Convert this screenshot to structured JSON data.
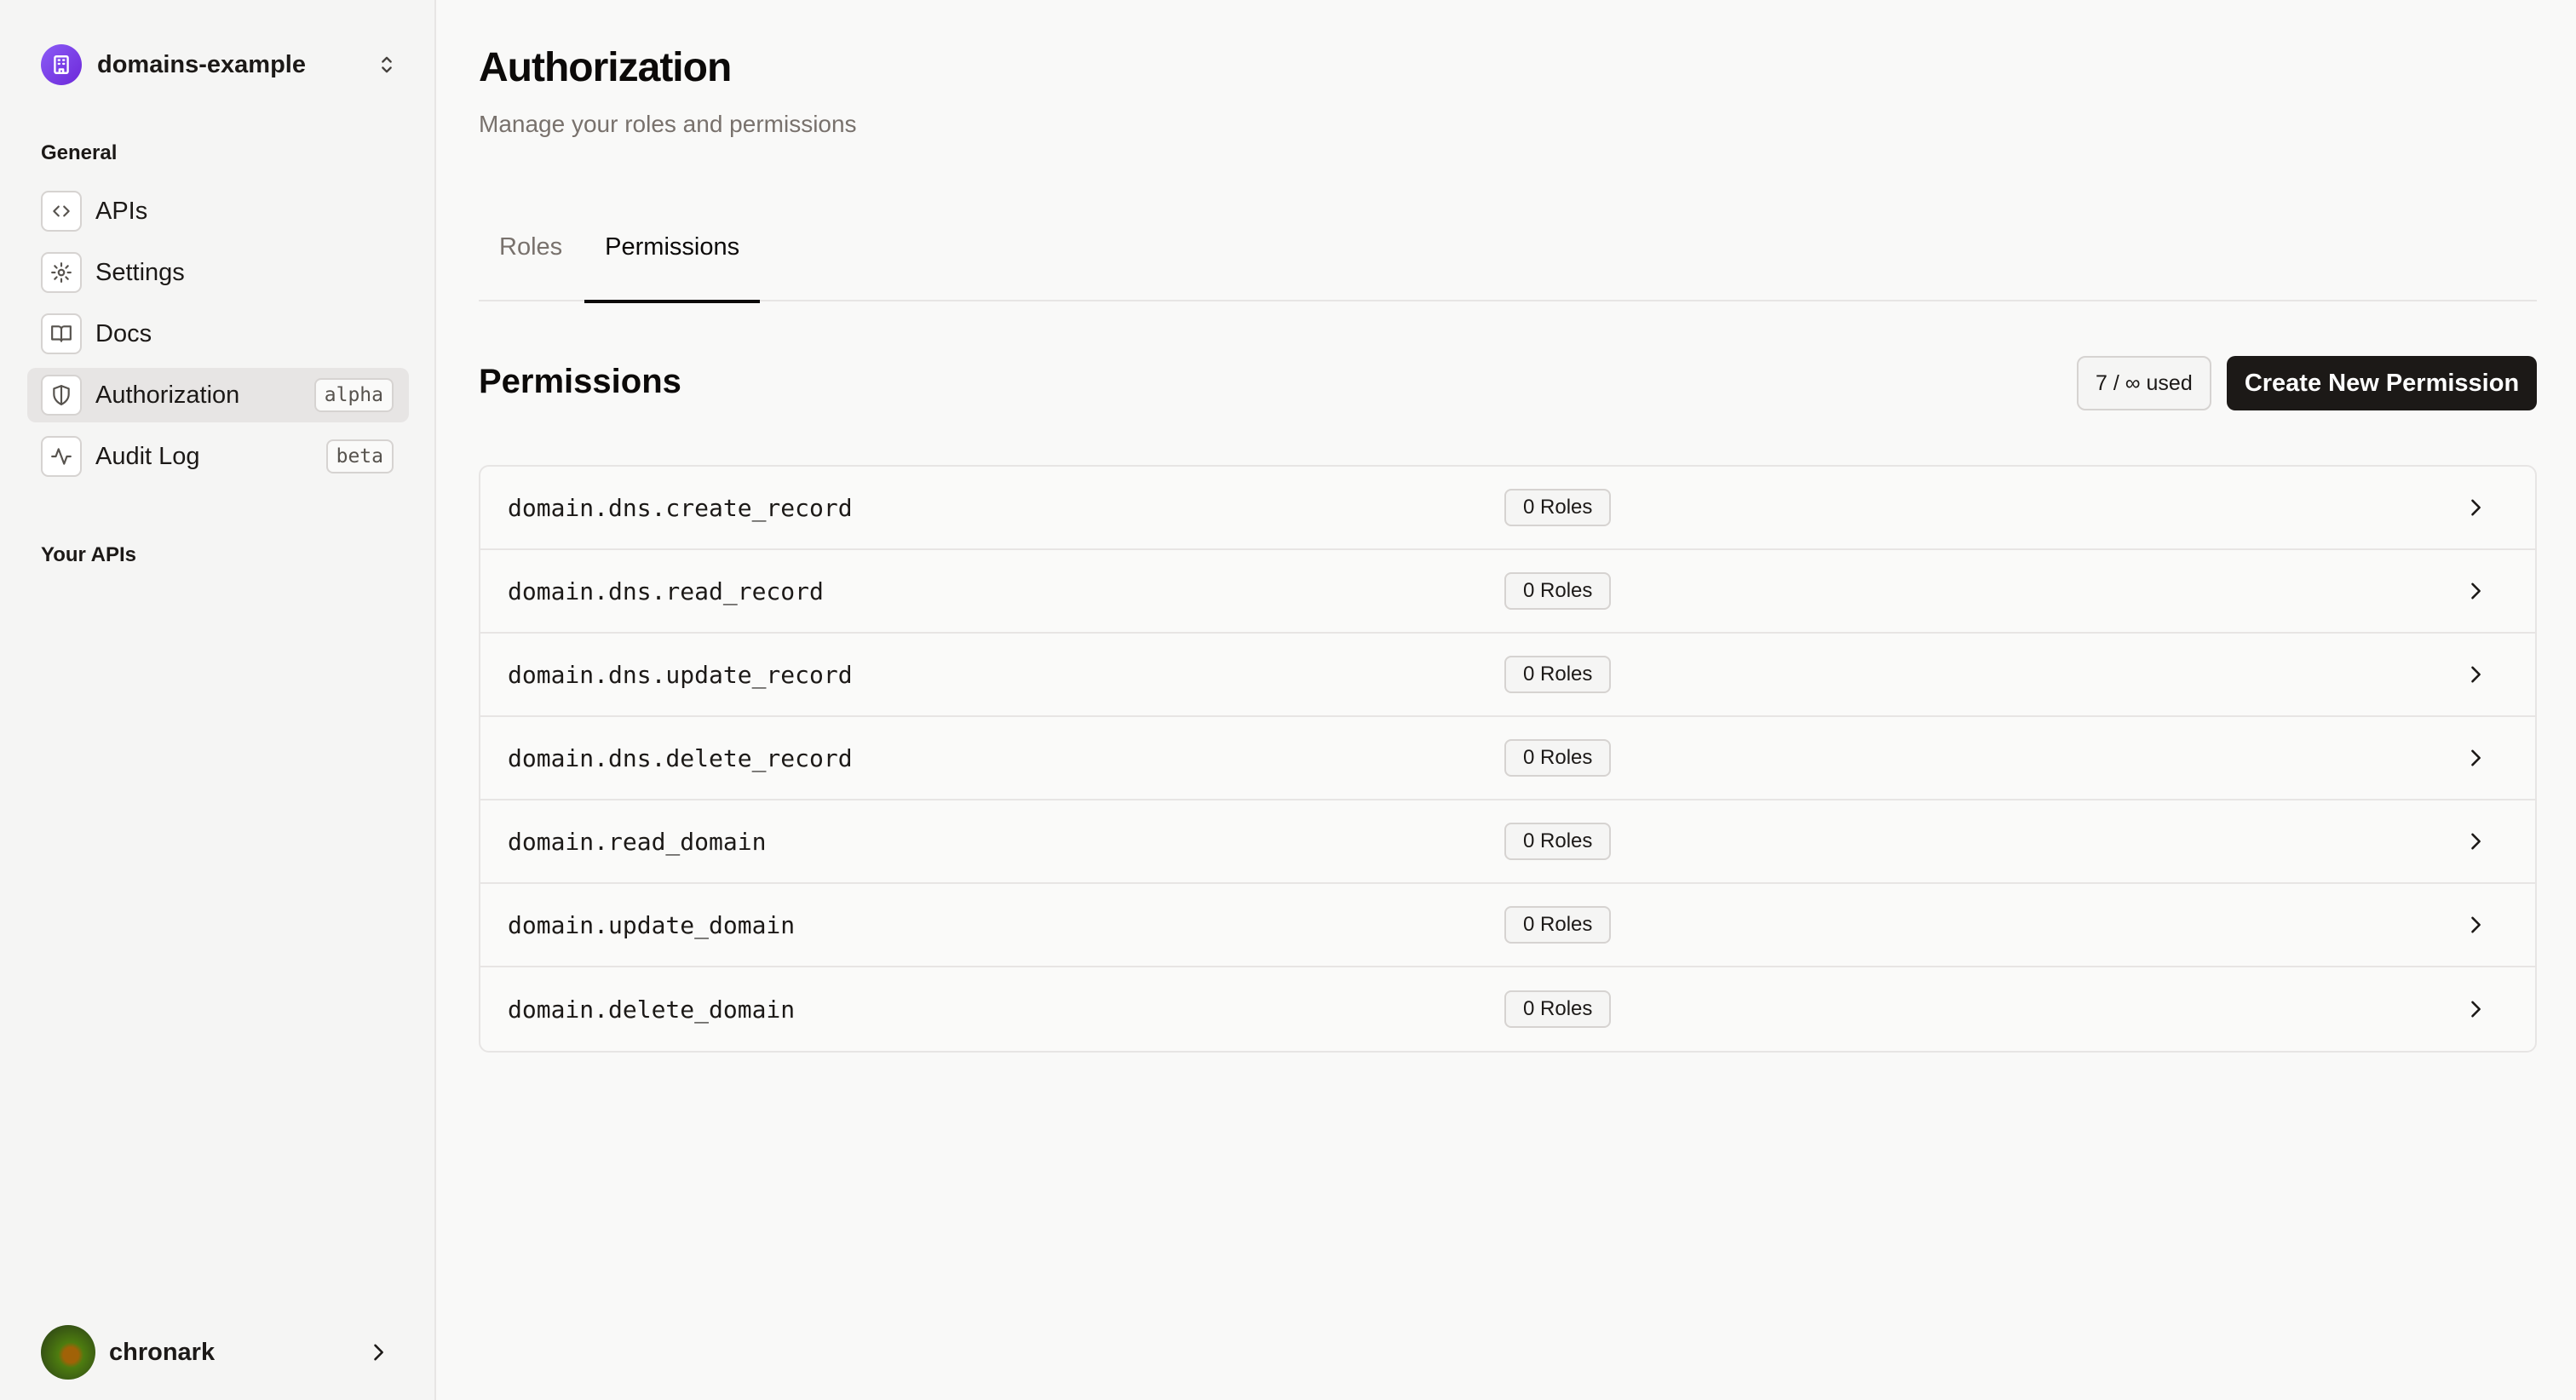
{
  "workspace": {
    "name": "domains-example"
  },
  "sidebar": {
    "general_label": "General",
    "items": [
      {
        "label": "APIs",
        "icon": "code-icon",
        "badge": ""
      },
      {
        "label": "Settings",
        "icon": "gear-icon",
        "badge": ""
      },
      {
        "label": "Docs",
        "icon": "book-icon",
        "badge": ""
      },
      {
        "label": "Authorization",
        "icon": "shield-icon",
        "badge": "alpha",
        "active": true
      },
      {
        "label": "Audit Log",
        "icon": "activity-icon",
        "badge": "beta"
      }
    ],
    "your_apis_label": "Your APIs"
  },
  "user": {
    "name": "chronark"
  },
  "page": {
    "title": "Authorization",
    "subtitle": "Manage your roles and permissions"
  },
  "tabs": [
    {
      "label": "Roles",
      "active": false
    },
    {
      "label": "Permissions",
      "active": true
    }
  ],
  "permissions": {
    "title": "Permissions",
    "usage": "7 / ∞ used",
    "create_button": "Create New Permission",
    "rows": [
      {
        "name": "domain.dns.create_record",
        "roles": "0 Roles"
      },
      {
        "name": "domain.dns.read_record",
        "roles": "0 Roles"
      },
      {
        "name": "domain.dns.update_record",
        "roles": "0 Roles"
      },
      {
        "name": "domain.dns.delete_record",
        "roles": "0 Roles"
      },
      {
        "name": "domain.read_domain",
        "roles": "0 Roles"
      },
      {
        "name": "domain.update_domain",
        "roles": "0 Roles"
      },
      {
        "name": "domain.delete_domain",
        "roles": "0 Roles"
      }
    ]
  },
  "colors": {
    "accent": "#1c1917",
    "workspace_avatar": "#7c3aed",
    "border": "#e7e5e4"
  }
}
